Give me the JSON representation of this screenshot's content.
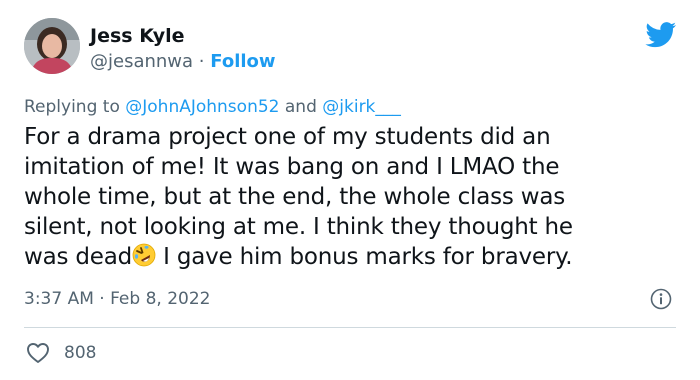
{
  "author": {
    "display_name": "Jess Kyle",
    "handle": "@jesannwa",
    "separator": "·",
    "follow_label": "Follow"
  },
  "icons": {
    "brand": "twitter-bird-icon",
    "info": "info-icon",
    "like": "heart-icon",
    "emoji": "rolling-on-the-floor-laughing-emoji"
  },
  "reply": {
    "prefix": "Replying to",
    "mention_1": "@JohnAJohnson52",
    "conjunction": "and",
    "mention_2": "@jkirk___"
  },
  "tweet": {
    "lines": [
      "For a drama project one of my students did an",
      "imitation of me!  It was bang on and I LMAO the",
      "whole time, but at the end, the whole class was",
      "silent, not looking at me. I think they thought he"
    ],
    "last_line_before_emoji": "was dead",
    "last_line_after_emoji": " I gave him bonus marks for bravery."
  },
  "meta": {
    "timestamp": "3:37 AM · Feb 8, 2022"
  },
  "actions": {
    "like_count": "808"
  },
  "colors": {
    "accent": "#1d9bf0",
    "secondary_text": "#536471",
    "divider": "#cfd9de"
  }
}
